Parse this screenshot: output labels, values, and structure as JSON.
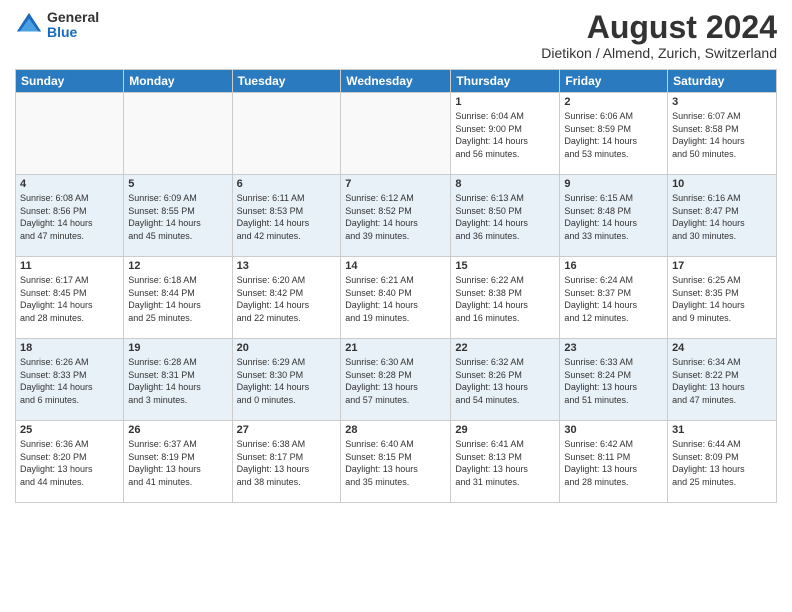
{
  "header": {
    "logo_general": "General",
    "logo_blue": "Blue",
    "month_year": "August 2024",
    "location": "Dietikon / Almend, Zurich, Switzerland"
  },
  "days_of_week": [
    "Sunday",
    "Monday",
    "Tuesday",
    "Wednesday",
    "Thursday",
    "Friday",
    "Saturday"
  ],
  "weeks": [
    [
      {
        "day": "",
        "info": ""
      },
      {
        "day": "",
        "info": ""
      },
      {
        "day": "",
        "info": ""
      },
      {
        "day": "",
        "info": ""
      },
      {
        "day": "1",
        "info": "Sunrise: 6:04 AM\nSunset: 9:00 PM\nDaylight: 14 hours\nand 56 minutes."
      },
      {
        "day": "2",
        "info": "Sunrise: 6:06 AM\nSunset: 8:59 PM\nDaylight: 14 hours\nand 53 minutes."
      },
      {
        "day": "3",
        "info": "Sunrise: 6:07 AM\nSunset: 8:58 PM\nDaylight: 14 hours\nand 50 minutes."
      }
    ],
    [
      {
        "day": "4",
        "info": "Sunrise: 6:08 AM\nSunset: 8:56 PM\nDaylight: 14 hours\nand 47 minutes."
      },
      {
        "day": "5",
        "info": "Sunrise: 6:09 AM\nSunset: 8:55 PM\nDaylight: 14 hours\nand 45 minutes."
      },
      {
        "day": "6",
        "info": "Sunrise: 6:11 AM\nSunset: 8:53 PM\nDaylight: 14 hours\nand 42 minutes."
      },
      {
        "day": "7",
        "info": "Sunrise: 6:12 AM\nSunset: 8:52 PM\nDaylight: 14 hours\nand 39 minutes."
      },
      {
        "day": "8",
        "info": "Sunrise: 6:13 AM\nSunset: 8:50 PM\nDaylight: 14 hours\nand 36 minutes."
      },
      {
        "day": "9",
        "info": "Sunrise: 6:15 AM\nSunset: 8:48 PM\nDaylight: 14 hours\nand 33 minutes."
      },
      {
        "day": "10",
        "info": "Sunrise: 6:16 AM\nSunset: 8:47 PM\nDaylight: 14 hours\nand 30 minutes."
      }
    ],
    [
      {
        "day": "11",
        "info": "Sunrise: 6:17 AM\nSunset: 8:45 PM\nDaylight: 14 hours\nand 28 minutes."
      },
      {
        "day": "12",
        "info": "Sunrise: 6:18 AM\nSunset: 8:44 PM\nDaylight: 14 hours\nand 25 minutes."
      },
      {
        "day": "13",
        "info": "Sunrise: 6:20 AM\nSunset: 8:42 PM\nDaylight: 14 hours\nand 22 minutes."
      },
      {
        "day": "14",
        "info": "Sunrise: 6:21 AM\nSunset: 8:40 PM\nDaylight: 14 hours\nand 19 minutes."
      },
      {
        "day": "15",
        "info": "Sunrise: 6:22 AM\nSunset: 8:38 PM\nDaylight: 14 hours\nand 16 minutes."
      },
      {
        "day": "16",
        "info": "Sunrise: 6:24 AM\nSunset: 8:37 PM\nDaylight: 14 hours\nand 12 minutes."
      },
      {
        "day": "17",
        "info": "Sunrise: 6:25 AM\nSunset: 8:35 PM\nDaylight: 14 hours\nand 9 minutes."
      }
    ],
    [
      {
        "day": "18",
        "info": "Sunrise: 6:26 AM\nSunset: 8:33 PM\nDaylight: 14 hours\nand 6 minutes."
      },
      {
        "day": "19",
        "info": "Sunrise: 6:28 AM\nSunset: 8:31 PM\nDaylight: 14 hours\nand 3 minutes."
      },
      {
        "day": "20",
        "info": "Sunrise: 6:29 AM\nSunset: 8:30 PM\nDaylight: 14 hours\nand 0 minutes."
      },
      {
        "day": "21",
        "info": "Sunrise: 6:30 AM\nSunset: 8:28 PM\nDaylight: 13 hours\nand 57 minutes."
      },
      {
        "day": "22",
        "info": "Sunrise: 6:32 AM\nSunset: 8:26 PM\nDaylight: 13 hours\nand 54 minutes."
      },
      {
        "day": "23",
        "info": "Sunrise: 6:33 AM\nSunset: 8:24 PM\nDaylight: 13 hours\nand 51 minutes."
      },
      {
        "day": "24",
        "info": "Sunrise: 6:34 AM\nSunset: 8:22 PM\nDaylight: 13 hours\nand 47 minutes."
      }
    ],
    [
      {
        "day": "25",
        "info": "Sunrise: 6:36 AM\nSunset: 8:20 PM\nDaylight: 13 hours\nand 44 minutes."
      },
      {
        "day": "26",
        "info": "Sunrise: 6:37 AM\nSunset: 8:19 PM\nDaylight: 13 hours\nand 41 minutes."
      },
      {
        "day": "27",
        "info": "Sunrise: 6:38 AM\nSunset: 8:17 PM\nDaylight: 13 hours\nand 38 minutes."
      },
      {
        "day": "28",
        "info": "Sunrise: 6:40 AM\nSunset: 8:15 PM\nDaylight: 13 hours\nand 35 minutes."
      },
      {
        "day": "29",
        "info": "Sunrise: 6:41 AM\nSunset: 8:13 PM\nDaylight: 13 hours\nand 31 minutes."
      },
      {
        "day": "30",
        "info": "Sunrise: 6:42 AM\nSunset: 8:11 PM\nDaylight: 13 hours\nand 28 minutes."
      },
      {
        "day": "31",
        "info": "Sunrise: 6:44 AM\nSunset: 8:09 PM\nDaylight: 13 hours\nand 25 minutes."
      }
    ]
  ]
}
